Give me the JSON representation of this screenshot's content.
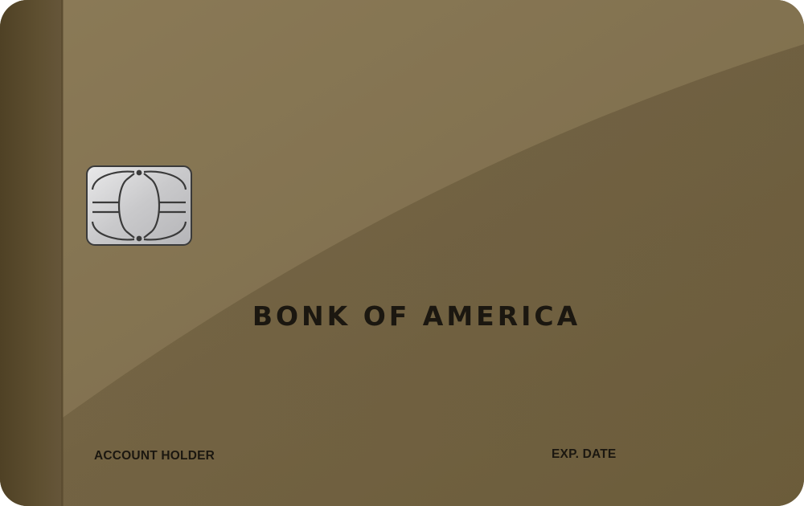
{
  "card": {
    "bank_name": "BONK OF AMERICA",
    "account_holder_label": "ACCOUNT HOLDER",
    "exp_date_label": "EXP. DATE",
    "colors": {
      "card_base": "#7d6d4c",
      "card_shadow_band": "#6b5c3e",
      "left_strip": "#5a4a2c",
      "text": "#1b1710",
      "chip_metal": "#cfcfd1"
    },
    "icons": {
      "chip": "emv-chip-icon"
    }
  }
}
